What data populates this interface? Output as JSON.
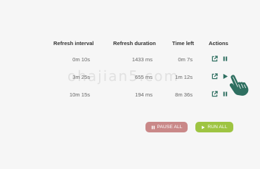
{
  "headers": {
    "refresh_interval": "Refresh interval",
    "refresh_duration": "Refresh duration",
    "time_left": "Time left",
    "actions": "Actions"
  },
  "rows": [
    {
      "interval": "0m 10s",
      "duration": "1433 ms",
      "time_left": "0m 7s",
      "state": "running"
    },
    {
      "interval": "3m 25s",
      "duration": "655 ms",
      "time_left": "1m 12s",
      "state": "paused"
    },
    {
      "interval": "10m 15s",
      "duration": "194 ms",
      "time_left": "8m 36s",
      "state": "running"
    }
  ],
  "buttons": {
    "pause_all": "PAUSE ALL",
    "run_all": "RUN ALL"
  },
  "watermark": "ohajian5.com",
  "colors": {
    "accent": "#2e6f60",
    "pause_button": "#c98888",
    "run_button": "#9ec442"
  },
  "icons": {
    "open": "external-link-icon",
    "pause": "pause-icon",
    "play": "play-icon"
  }
}
